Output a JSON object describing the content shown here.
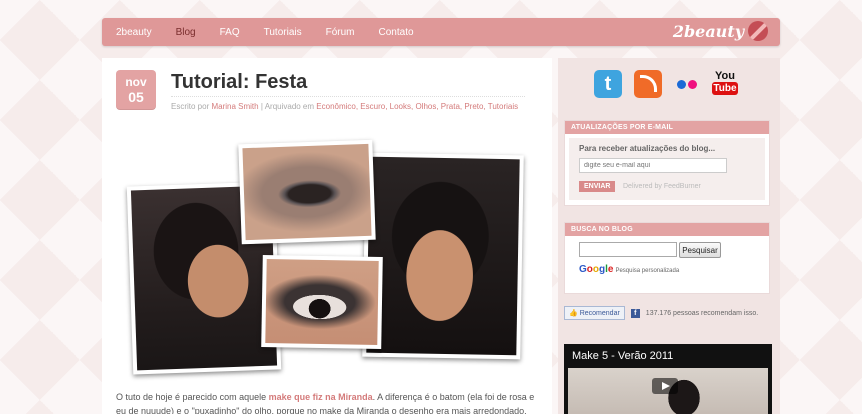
{
  "nav": {
    "items": [
      "2beauty",
      "Blog",
      "FAQ",
      "Tutoriais",
      "Fórum",
      "Contato"
    ],
    "brand": "2beauty",
    "accent": "#df9898"
  },
  "post": {
    "date_month": "nov",
    "date_day": "05",
    "title": "Tutorial: Festa",
    "meta_prefix": "Escrito por",
    "author": "Marina Smith",
    "meta_archived": "| Arquivado em",
    "categories": "Econômico, Escuro, Looks, Olhos, Prata, Preto, Tutoriais",
    "text_1": "O tuto de hoje é parecido com aquele",
    "text_link": "make que fiz na Miranda",
    "text_2": ". A diferença é o batom (ela foi de rosa e eu de nuuude) e o \"puxadinho\" do olho, porque no make da Miranda o desenho era mais arredondado."
  },
  "sidebar": {
    "social_icons": [
      "twitter-icon",
      "rss-icon",
      "flickr-icon",
      "youtube-icon"
    ],
    "youtube_top": "You",
    "youtube_bottom": "Tube",
    "email": {
      "heading": "ATUALIZAÇÕES POR E-MAIL",
      "prompt": "Para receber atualizações do blog...",
      "placeholder": "digite seu e-mail aqui",
      "button": "ENVIAR",
      "delivered": "Delivered by FeedBurner"
    },
    "search": {
      "heading": "BUSCA NO BLOG",
      "button": "Pesquisar",
      "google_label": "Pesquisa personalizada"
    },
    "like": {
      "button": "Recomendar",
      "count_text": "137.176 pessoas recomendam isso."
    },
    "video_title": "Make 5 - Verão 2011"
  }
}
